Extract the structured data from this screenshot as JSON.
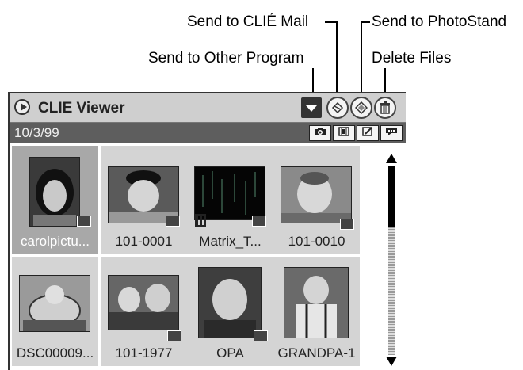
{
  "callouts": {
    "send_mail": "Send to CLIÉ Mail",
    "send_photostand": "Send to PhotoStand",
    "send_other": "Send to Other Program",
    "delete_files": "Delete Files"
  },
  "app": {
    "title": "CLIE Viewer",
    "date": "10/3/99"
  },
  "toolbar": {
    "dropdown_icon": "dropdown-arrow-icon",
    "mail_icon": "envelope-icon",
    "photostand_icon": "photostand-icon",
    "delete_icon": "trash-icon"
  },
  "modes": [
    "camera-icon",
    "movie-icon",
    "memo-icon",
    "speech-icon"
  ],
  "thumbnails": [
    {
      "caption": "carolpictu...",
      "selected": true,
      "badge": "file-icon"
    },
    {
      "caption": "101-0001",
      "selected": false,
      "badge": "file-icon"
    },
    {
      "caption": "Matrix_T...",
      "selected": false,
      "badge": "file-icon",
      "type": "movie"
    },
    {
      "caption": "101-0010",
      "selected": false,
      "badge": "card-icon"
    },
    {
      "caption": "DSC00009...",
      "selected": false,
      "badge": "none"
    },
    {
      "caption": "101-1977",
      "selected": false,
      "badge": "card-icon"
    },
    {
      "caption": "OPA",
      "selected": false,
      "badge": "card-icon"
    },
    {
      "caption": "GRANDPA-1",
      "selected": false,
      "badge": "none"
    }
  ]
}
